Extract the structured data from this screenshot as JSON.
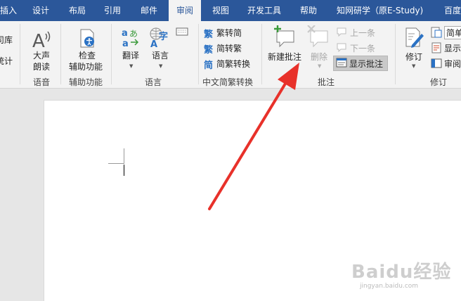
{
  "tabs": [
    {
      "label": "插入"
    },
    {
      "label": "设计"
    },
    {
      "label": "布局"
    },
    {
      "label": "引用"
    },
    {
      "label": "邮件"
    },
    {
      "label": "审阅"
    },
    {
      "label": "视图"
    },
    {
      "label": "开发工具"
    },
    {
      "label": "帮助"
    },
    {
      "label": "知网研学（原E-Study)"
    },
    {
      "label": "百度"
    }
  ],
  "ribbon": {
    "partial_left": {
      "top": "司库",
      "bottom": "统计"
    },
    "speech": {
      "line1": "大声",
      "line2": "朗读",
      "group": "语音"
    },
    "accessibility": {
      "line1": "检查",
      "line2": "辅助功能",
      "group": "辅助功能"
    },
    "language": {
      "translate": "翻译",
      "language": "语言",
      "group": "语言"
    },
    "chinese": {
      "to_traditional": "繁转简",
      "to_simplified": "简转繁",
      "convert": "简繁转换",
      "group": "中文简繁转换"
    },
    "comments": {
      "new": "新建批注",
      "delete": "删除",
      "previous": "上一条",
      "next": "下一条",
      "show": "显示批注",
      "group": "批注"
    },
    "tracking": {
      "track": "修订",
      "simple": "简单",
      "show_markup": "显示",
      "review": "审阅",
      "group": "修订"
    }
  },
  "watermark": {
    "main": "Baidu经验",
    "sub": "jingyan.baidu.com"
  },
  "colors": {
    "accent": "#2b579a",
    "arrow": "#e8312a"
  }
}
